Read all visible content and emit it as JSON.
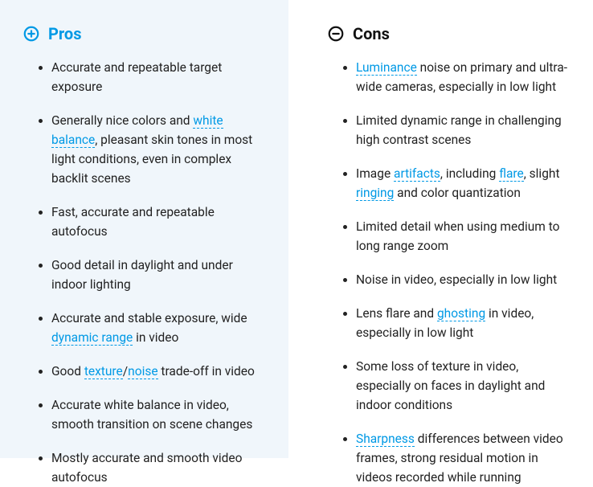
{
  "pros": {
    "title": "Pros",
    "items": [
      {
        "segments": [
          {
            "t": "Accurate and repeatable target exposure"
          }
        ]
      },
      {
        "segments": [
          {
            "t": "Generally nice colors and "
          },
          {
            "t": "white balance",
            "link": true
          },
          {
            "t": ", pleasant skin tones in most light conditions, even in complex backlit scenes"
          }
        ]
      },
      {
        "segments": [
          {
            "t": "Fast, accurate and repeatable autofocus"
          }
        ]
      },
      {
        "segments": [
          {
            "t": "Good detail in daylight and under indoor lighting"
          }
        ]
      },
      {
        "segments": [
          {
            "t": "Accurate and stable exposure, wide "
          },
          {
            "t": "dynamic range",
            "link": true
          },
          {
            "t": " in video"
          }
        ]
      },
      {
        "segments": [
          {
            "t": "Good "
          },
          {
            "t": "texture",
            "link": true
          },
          {
            "t": "/"
          },
          {
            "t": "noise",
            "link": true
          },
          {
            "t": " trade-off in video"
          }
        ]
      },
      {
        "segments": [
          {
            "t": "Accurate white balance in video, smooth transition on scene changes"
          }
        ]
      },
      {
        "segments": [
          {
            "t": "Mostly accurate and smooth video autofocus"
          }
        ]
      }
    ]
  },
  "cons": {
    "title": "Cons",
    "items": [
      {
        "segments": [
          {
            "t": "Luminance",
            "link": true
          },
          {
            "t": " noise on primary and ultra-wide cameras, especially in low light"
          }
        ]
      },
      {
        "segments": [
          {
            "t": "Limited dynamic range in challenging high contrast scenes"
          }
        ]
      },
      {
        "segments": [
          {
            "t": "Image "
          },
          {
            "t": "artifacts",
            "link": true
          },
          {
            "t": ", including "
          },
          {
            "t": "flare",
            "link": true
          },
          {
            "t": ", slight "
          },
          {
            "t": "ringing",
            "link": true
          },
          {
            "t": " and  color quantization"
          }
        ]
      },
      {
        "segments": [
          {
            "t": "Limited detail when using medium to long range zoom"
          }
        ]
      },
      {
        "segments": [
          {
            "t": "Noise in video, especially in low light"
          }
        ]
      },
      {
        "segments": [
          {
            "t": "Lens flare and "
          },
          {
            "t": "ghosting",
            "link": true
          },
          {
            "t": " in video, especially in low light"
          }
        ]
      },
      {
        "segments": [
          {
            "t": "Some loss of texture in video, especially on faces in daylight and indoor conditions"
          }
        ]
      },
      {
        "segments": [
          {
            "t": "Sharpness",
            "link": true
          },
          {
            "t": " differences between video frames, strong residual motion in videos recorded while running"
          }
        ]
      }
    ]
  }
}
